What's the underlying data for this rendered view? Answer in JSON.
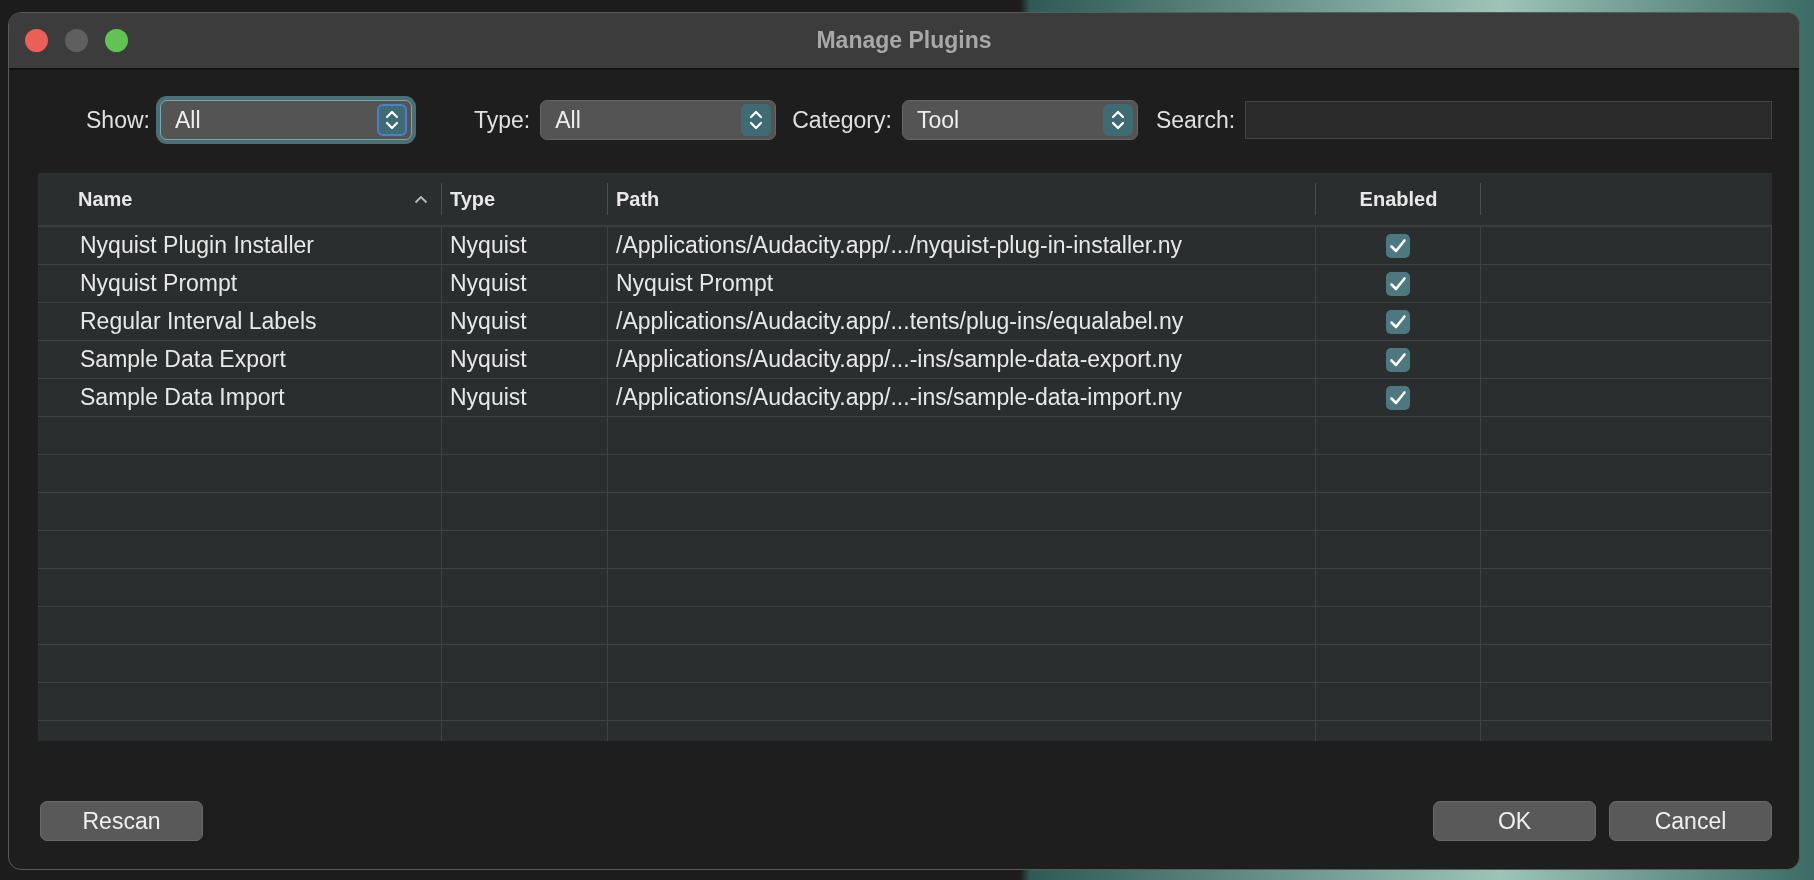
{
  "window": {
    "title": "Manage Plugins"
  },
  "filters": [
    {
      "kind": "select",
      "label": "Show:",
      "value": "All",
      "focused": true
    },
    {
      "kind": "select",
      "label": "Type:",
      "value": "All",
      "focused": false
    },
    {
      "kind": "select",
      "label": "Category:",
      "value": "Tool",
      "focused": false
    },
    {
      "kind": "search",
      "label": "Search:"
    }
  ],
  "table": {
    "columns": [
      {
        "label": "Name",
        "sorted": true
      },
      {
        "label": "Type",
        "sorted": false
      },
      {
        "label": "Path",
        "sorted": false
      },
      {
        "label": "Enabled",
        "sorted": false
      }
    ],
    "rows": [
      {
        "name": "Nyquist Plugin Installer",
        "type": "Nyquist",
        "path": "/Applications/Audacity.app/.../nyquist-plug-in-installer.ny",
        "enabled": true
      },
      {
        "name": "Nyquist Prompt",
        "type": "Nyquist",
        "path": "Nyquist Prompt",
        "enabled": true
      },
      {
        "name": "Regular Interval Labels",
        "type": "Nyquist",
        "path": "/Applications/Audacity.app/...tents/plug-ins/equalabel.ny",
        "enabled": true
      },
      {
        "name": "Sample Data Export",
        "type": "Nyquist",
        "path": "/Applications/Audacity.app/...-ins/sample-data-export.ny",
        "enabled": true
      },
      {
        "name": "Sample Data Import",
        "type": "Nyquist",
        "path": "/Applications/Audacity.app/...-ins/sample-data-import.ny",
        "enabled": true
      }
    ]
  },
  "buttons": {
    "left": [
      {
        "label": "Rescan"
      }
    ],
    "right": [
      {
        "label": "OK"
      },
      {
        "label": "Cancel"
      }
    ]
  }
}
